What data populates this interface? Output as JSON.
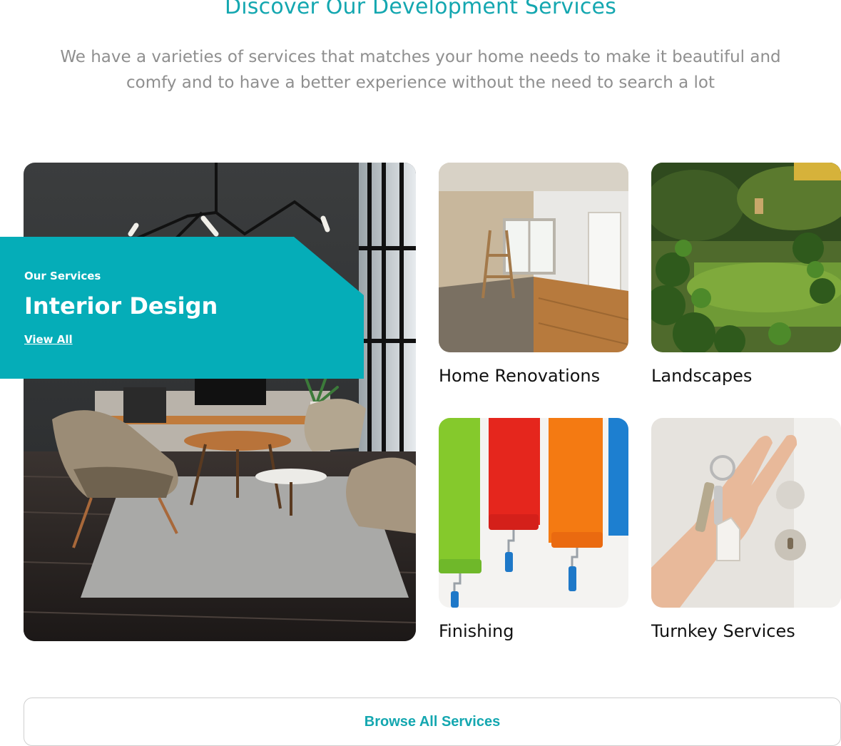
{
  "header": {
    "title": "Discover Our Development Services",
    "subtitle": "We have a varieties of services that matches your home needs to make it beautiful and comfy and to have a better experience without the need to search a lot"
  },
  "feature": {
    "eyebrow": "Our Services",
    "title": "Interior Design",
    "link_label": "View All",
    "accent_color": "#05adb8"
  },
  "services": [
    {
      "label": "Home Renovations",
      "image": "renovation-room-image"
    },
    {
      "label": "Landscapes",
      "image": "garden-plants-image"
    },
    {
      "label": "Finishing",
      "image": "paint-rollers-image"
    },
    {
      "label": "Turnkey Services",
      "image": "house-keys-image"
    }
  ],
  "browse": {
    "label": "Browse All Services"
  },
  "colors": {
    "accent": "#14a7b0",
    "muted_text": "#8f8f8f"
  }
}
